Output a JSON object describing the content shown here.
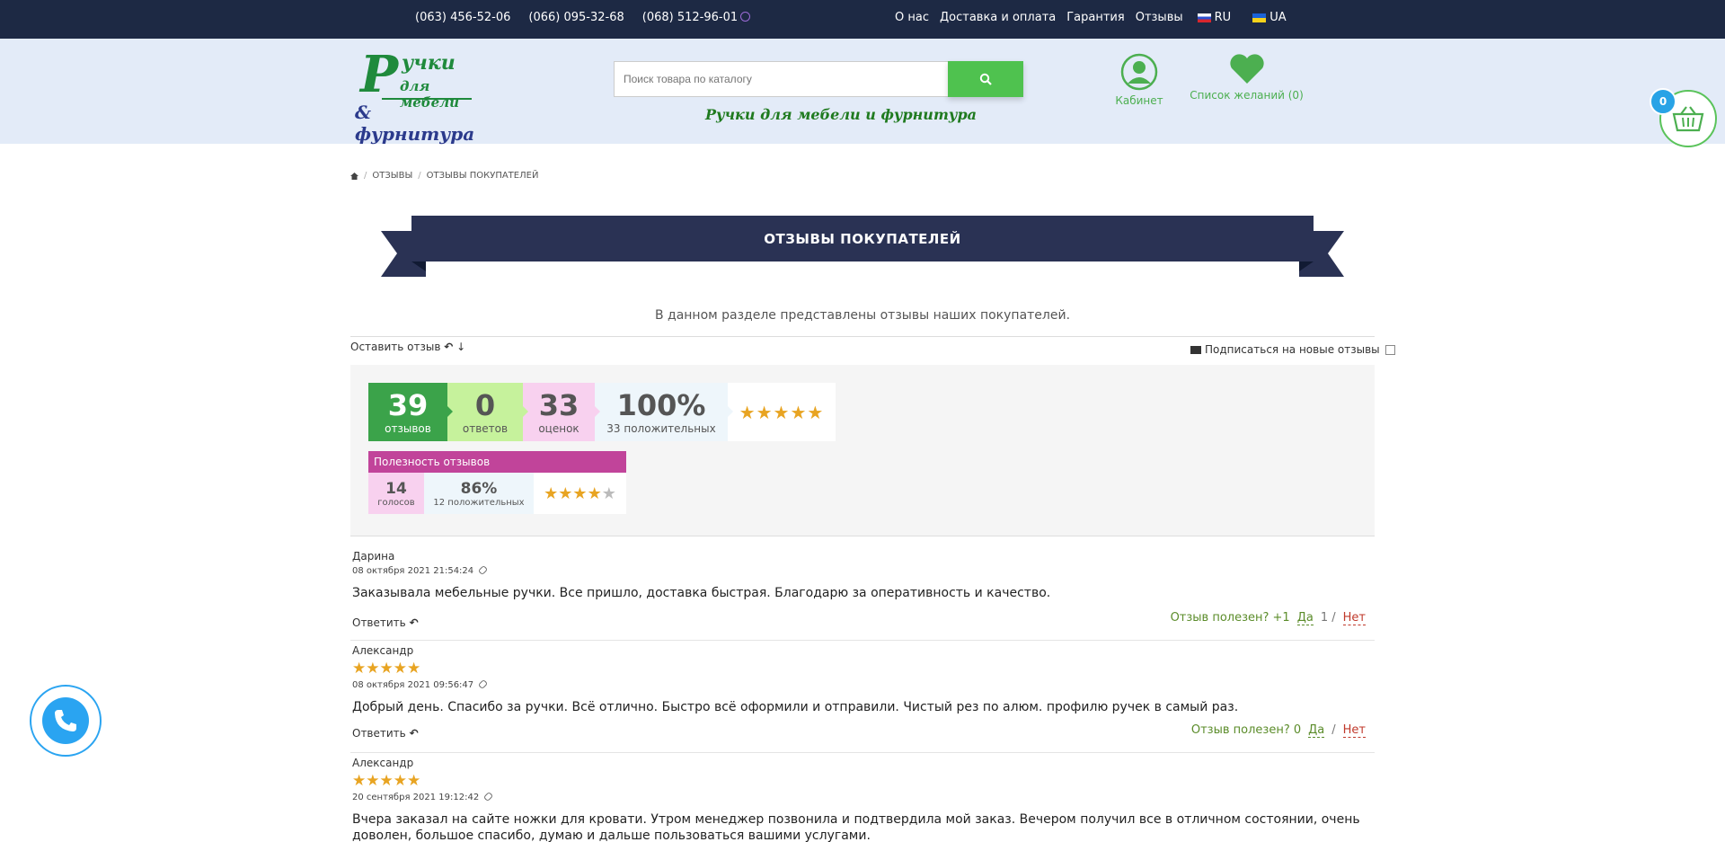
{
  "topbar": {
    "phones": [
      "(063) 456-52-06",
      "(066) 095-32-68",
      "(068) 512-96-01"
    ],
    "nav": [
      "О нас",
      "Доставка и оплата",
      "Гарантия",
      "Отзывы"
    ],
    "lang_ru": "RU",
    "lang_ua": "UA"
  },
  "header": {
    "logo": {
      "line1": "Р",
      "line1b": "учки",
      "line2": "для мебели",
      "line3": "& фурнитура"
    },
    "search_placeholder": "Поиск товара по каталогу",
    "tagline": "Ручки для мебели и фурнитура",
    "cabinet": "Кабинет",
    "wishlist": "Список желаний (0)",
    "cart_count": "0",
    "colors": {
      "accent": "#4fc24f",
      "topbar": "#1d2944",
      "header_bg": "#e3ebf8"
    }
  },
  "breadcrumb": {
    "home_icon": "home-icon",
    "items": [
      "Отзывы",
      "Отзывы покупателей"
    ]
  },
  "page": {
    "title": "ОТЗЫВЫ ПОКУПАТЕЛЕЙ",
    "intro": "В данном разделе представлены отзывы наших покупателей.",
    "leave_review": "Оставить отзыв",
    "subscribe": "Подписаться на новые отзывы"
  },
  "stats": {
    "reviews_n": "39",
    "reviews_t": "отзывов",
    "answers_n": "0",
    "answers_t": "ответов",
    "ratings_n": "33",
    "ratings_t": "оценок",
    "positive_n": "100%",
    "positive_t": "33 положительных",
    "stars": "★★★★★",
    "usefulness_title": "Полезность отзывов",
    "votes_n": "14",
    "votes_t": "голосов",
    "useful_pct": "86%",
    "useful_t": "12 положительных",
    "useful_stars": "★★★★",
    "useful_stars_empty": "★"
  },
  "reviews": [
    {
      "author": "Дарина",
      "stars": "",
      "date": "08 октября 2021 21:54:24",
      "text": "Заказывала мебельные ручки. Все пришло, доставка быстрая. Благодарю за оперативность и качество.",
      "reply": "Ответить",
      "useful_label": "Отзыв полезен? +1",
      "yes": "Да",
      "yes_count": "1 /",
      "no": "Нет"
    },
    {
      "author": "Александр",
      "stars": "★★★★★",
      "date": "08 октября 2021 09:56:47",
      "text": "Добрый день. Спасибо за ручки. Всё отлично. Быстро всё оформили и отправили. Чистый рез по алюм. профилю ручек в самый раз.",
      "reply": "Ответить",
      "useful_label": "Отзыв полезен? 0",
      "yes": "Да",
      "yes_count": "/",
      "no": "Нет"
    },
    {
      "author": "Александр",
      "stars": "★★★★★",
      "date": "20 сентября 2021 19:12:42",
      "text": "Вчера заказал на сайте ножки для кровати. Утром менеджер позвонила и подтвердила мой заказ. Вечером получил все в отличном состоянии, очень доволен, большое спасибо, думаю и дальше пользоваться вашими услугами."
    }
  ]
}
